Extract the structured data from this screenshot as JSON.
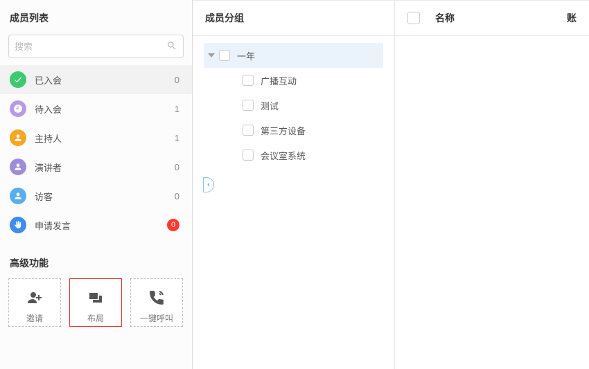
{
  "left": {
    "title": "成员列表",
    "search_placeholder": "搜索",
    "statuses": [
      {
        "id": "joined",
        "label": "已入会",
        "count": "0",
        "color": "#3fc96e",
        "icon": "check",
        "selected": true
      },
      {
        "id": "pending",
        "label": "待入会",
        "count": "1",
        "color": "#b89be6",
        "icon": "clock",
        "selected": false
      },
      {
        "id": "host",
        "label": "主持人",
        "count": "1",
        "color": "#f5a623",
        "icon": "person",
        "selected": false
      },
      {
        "id": "speaker",
        "label": "演讲者",
        "count": "0",
        "color": "#9f8bd9",
        "icon": "person",
        "selected": false
      },
      {
        "id": "guest",
        "label": "访客",
        "count": "0",
        "color": "#5aaef0",
        "icon": "person",
        "selected": false
      },
      {
        "id": "request",
        "label": "申请发言",
        "count": "0",
        "color": "#3d8cf0",
        "icon": "hand",
        "selected": false,
        "badge": true
      }
    ],
    "advanced_title": "高级功能",
    "funcs": [
      {
        "id": "invite",
        "label": "邀请",
        "icon": "person-add"
      },
      {
        "id": "layout",
        "label": "布局",
        "icon": "layout",
        "highlight": true
      },
      {
        "id": "call",
        "label": "一键呼叫",
        "icon": "phone"
      }
    ]
  },
  "mid": {
    "title": "成员分组",
    "tree": {
      "label": "一年",
      "expanded": true,
      "children": [
        {
          "label": "广播互动"
        },
        {
          "label": "测试"
        },
        {
          "label": "第三方设备"
        },
        {
          "label": "会议室系统"
        }
      ]
    }
  },
  "right": {
    "col_name": "名称",
    "col_account": "账"
  }
}
